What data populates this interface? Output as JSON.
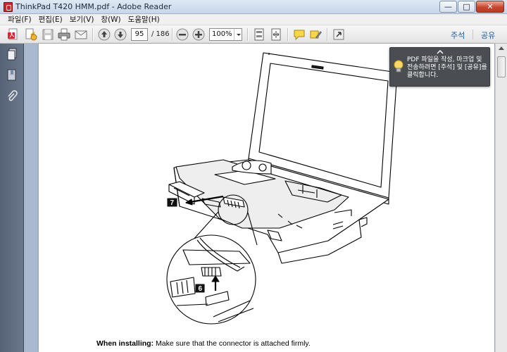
{
  "window": {
    "title": "ThinkPad T420 HMM.pdf - Adobe Reader",
    "min_glyph": "—",
    "max_glyph": "□",
    "close_glyph": "✕"
  },
  "menu": {
    "items": [
      "파일(F)",
      "편집(E)",
      "보기(V)",
      "창(W)",
      "도움말(H)"
    ]
  },
  "toolbar": {
    "current_page": "95",
    "total_pages": "/ 186",
    "zoom": "100%",
    "comment_label": "주석",
    "share_label": "공유"
  },
  "tooltip": {
    "text": "PDF 파일을 작성, 마크업 및 전송하려면 [주석] 및 [공유]를 클릭합니다."
  },
  "document": {
    "step7_label": "7",
    "step6_label": "6",
    "caption_bold": "When installing:",
    "caption_text": " Make sure that the connector is attached firmly."
  },
  "icons": [
    "create-pdf-icon",
    "open-icon",
    "save-icon",
    "print-icon",
    "email-icon",
    "prev-page-icon",
    "next-page-icon",
    "zoom-out-icon",
    "zoom-in-icon",
    "fit-page-icon",
    "fit-width-icon",
    "comment-icon",
    "highlight-icon",
    "fullscreen-icon",
    "pages-icon",
    "bookmarks-icon",
    "attachments-icon",
    "lightbulb-icon"
  ]
}
